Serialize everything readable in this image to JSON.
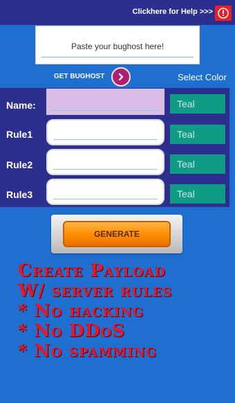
{
  "header": {
    "help_text": "Clickhere for Help >>>"
  },
  "bughost": {
    "placeholder": "Paste your bughost here!"
  },
  "actions": {
    "get_bughost_label": "GET BUGHOST",
    "select_color_label": "Select Color"
  },
  "form": {
    "rows": [
      {
        "label": "Name:",
        "color": "Teal"
      },
      {
        "label": "Rule1",
        "color": "Teal"
      },
      {
        "label": "Rule2",
        "color": "Teal"
      },
      {
        "label": "Rule3",
        "color": "Teal"
      }
    ]
  },
  "generate": {
    "label": "GENERATE"
  },
  "promo": {
    "lines": [
      "Create Payload",
      "W/ server rules",
      "* No hacking",
      "* No DDoS",
      "* No spamming"
    ]
  },
  "colors": {
    "background": "#1e6fd0",
    "panel": "#2d2f8f",
    "teal": "#0f9b86",
    "promo_text": "#e01a2a",
    "name_field": "#d9bde6"
  }
}
